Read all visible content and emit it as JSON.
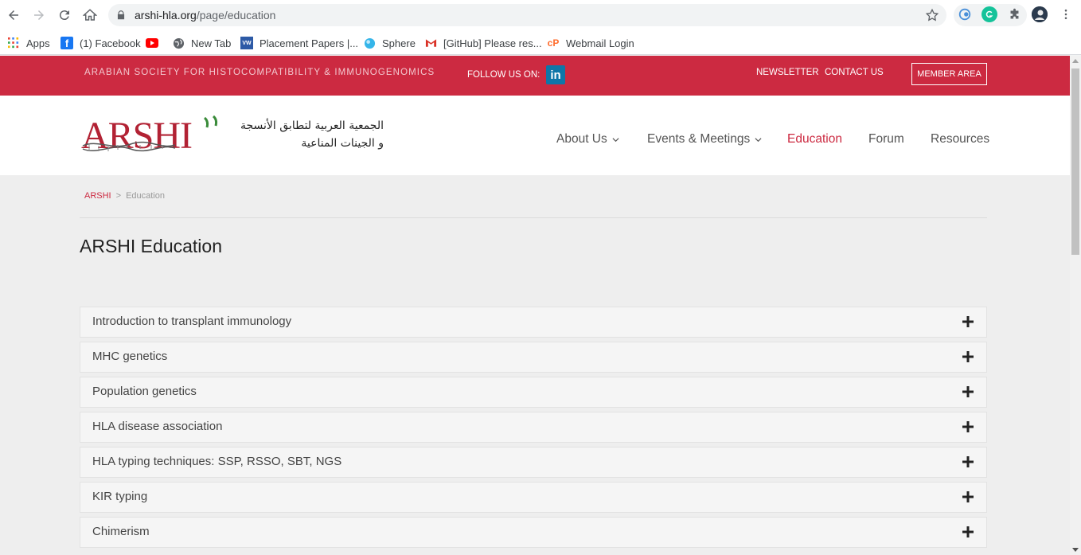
{
  "browser": {
    "url_host": "arshi-hla.org",
    "url_path": "/page/education",
    "bookmarks": [
      {
        "label": "Apps",
        "icon": "apps-grid-icon"
      },
      {
        "label": "(1) Facebook",
        "icon": "facebook-icon"
      },
      {
        "label": "",
        "icon": "youtube-icon"
      },
      {
        "label": "New Tab",
        "icon": "globe-icon"
      },
      {
        "label": "Placement Papers |...",
        "icon": "vw-icon"
      },
      {
        "label": "Sphere",
        "icon": "sphere-icon"
      },
      {
        "label": "[GitHub] Please res...",
        "icon": "gmail-icon"
      },
      {
        "label": "Webmail Login",
        "icon": "cpanel-icon"
      }
    ]
  },
  "topbar": {
    "society": "ARABIAN SOCIETY FOR HISTOCOMPATIBILITY & IMMUNOGENOMICS",
    "follow": "FOLLOW US ON:",
    "linkedin": "in",
    "newsletter": "NEWSLETTER",
    "contact": "CONTACT US",
    "member": "MEMBER AREA",
    "color": "#cc2a41"
  },
  "header": {
    "logo_text": "ARSHI",
    "arabic_line1": "الجمعية العربية لتطابق الأنسجة",
    "arabic_line2": "و الجينات المناعية",
    "nav": [
      {
        "label": "About Us"
      },
      {
        "label": "Events & Meetings"
      },
      {
        "label": "Education"
      },
      {
        "label": "Forum"
      },
      {
        "label": "Resources"
      }
    ]
  },
  "breadcrumb": {
    "home": "ARSHI",
    "separator": ">",
    "current": "Education"
  },
  "main": {
    "title": "ARSHI Education",
    "sections": [
      "Introduction to transplant immunology",
      "MHC genetics",
      "Population genetics",
      "HLA disease association",
      "HLA typing techniques: SSP, RSSO, SBT, NGS",
      "KIR typing",
      "Chimerism"
    ]
  }
}
